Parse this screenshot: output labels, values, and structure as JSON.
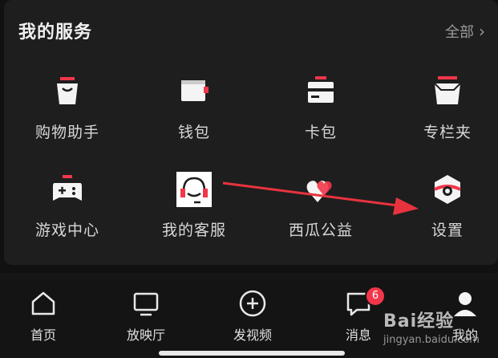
{
  "section": {
    "title": "我的服务",
    "all_label": "全部"
  },
  "services": [
    {
      "label": "购物助手",
      "icon": "shopping-bag-icon"
    },
    {
      "label": "钱包",
      "icon": "wallet-icon"
    },
    {
      "label": "卡包",
      "icon": "card-pack-icon"
    },
    {
      "label": "专栏夹",
      "icon": "column-folder-icon"
    },
    {
      "label": "游戏中心",
      "icon": "gamepad-icon"
    },
    {
      "label": "我的客服",
      "icon": "headset-icon"
    },
    {
      "label": "西瓜公益",
      "icon": "charity-hearts-icon"
    },
    {
      "label": "设置",
      "icon": "settings-icon"
    }
  ],
  "tabbar": {
    "items": [
      {
        "label": "首页",
        "icon": "home-icon"
      },
      {
        "label": "放映厅",
        "icon": "tv-icon"
      },
      {
        "label": "发视频",
        "icon": "plus-circle-icon"
      },
      {
        "label": "消息",
        "icon": "message-icon",
        "badge": "6"
      },
      {
        "label": "我的",
        "icon": "profile-icon"
      }
    ]
  },
  "watermark": {
    "logo": "Bai经验",
    "url": "jingyan.baidu.com"
  },
  "colors": {
    "background": "#111111",
    "card": "#1e1e1e",
    "accent_red": "#f2364a",
    "arrow_red": "#e8333f",
    "text": "#e8e8e8",
    "muted": "#9a9a9a"
  }
}
